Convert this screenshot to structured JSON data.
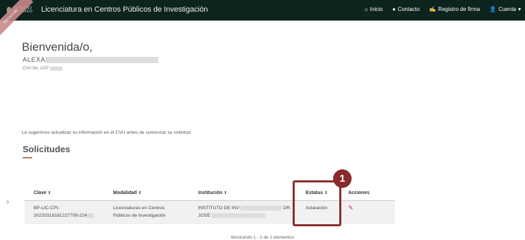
{
  "header": {
    "logo_text": "GOBIERNO DE MÉXICO",
    "title": "Licenciatura en Centros Públicos de Investigación",
    "nav": [
      {
        "icon": "home-icon",
        "label": "Inicio"
      },
      {
        "icon": "chat-icon",
        "label": "Contacto"
      },
      {
        "icon": "signature-icon",
        "label": "Registro de firma"
      },
      {
        "icon": "user-icon",
        "label": "Cuenta"
      }
    ]
  },
  "ribbon_text": "Desarrollo",
  "welcome": {
    "greeting": "Bienvenida/o,",
    "name_prefix": "ALEXA",
    "cvu_label": "CVU No. 1197"
  },
  "suggestion": "Le sugerimos actualizar su información en el CVU antes de comenzar su solicitud.",
  "section_title": "Solicitudes",
  "table": {
    "columns": [
      "Clave",
      "Modalidad",
      "Institución",
      "Estatus",
      "Acciones"
    ],
    "rows": [
      {
        "clave_line1": "BP-LIC-CPI-",
        "clave_line2": "20220318181227709-224",
        "modalidad_line1": "Licenciaturas en Centros",
        "modalidad_line2": "Públicos de Investigación",
        "institucion_line1": "INSTITUTO DE INV",
        "institucion_line1_end": "DR.",
        "institucion_line2": "JOSE",
        "estatus": "Aclaración"
      }
    ]
  },
  "annotation_number": "1",
  "side_mark": "?",
  "footer": "Mostrando 1 - 1 de 1 elementos",
  "colors": {
    "topbar": "#0c231e",
    "accent": "#8a2a2a",
    "edit": "#c03050"
  }
}
